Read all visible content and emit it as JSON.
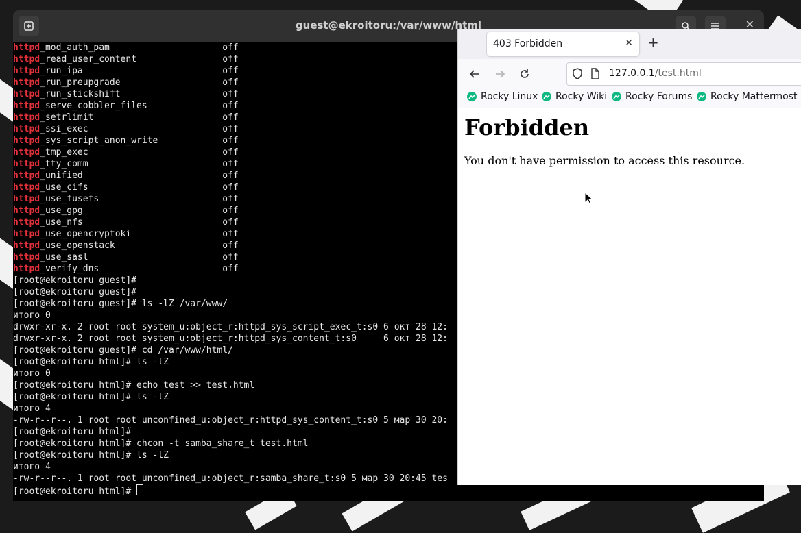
{
  "terminal": {
    "title": "guest@ekroitoru:/var/www/html",
    "lines": [
      [
        {
          "t": "httpd",
          "k": 1
        },
        {
          "t": "_mod_auth_pam                     off"
        }
      ],
      [
        {
          "t": "httpd",
          "k": 1
        },
        {
          "t": "_read_user_content                off"
        }
      ],
      [
        {
          "t": "httpd",
          "k": 1
        },
        {
          "t": "_run_ipa                          off"
        }
      ],
      [
        {
          "t": "httpd",
          "k": 1
        },
        {
          "t": "_run_preupgrade                   off"
        }
      ],
      [
        {
          "t": "httpd",
          "k": 1
        },
        {
          "t": "_run_stickshift                   off"
        }
      ],
      [
        {
          "t": "httpd",
          "k": 1
        },
        {
          "t": "_serve_cobbler_files              off"
        }
      ],
      [
        {
          "t": "httpd",
          "k": 1
        },
        {
          "t": "_setrlimit                        off"
        }
      ],
      [
        {
          "t": "httpd",
          "k": 1
        },
        {
          "t": "_ssi_exec                         off"
        }
      ],
      [
        {
          "t": "httpd",
          "k": 1
        },
        {
          "t": "_sys_script_anon_write            off"
        }
      ],
      [
        {
          "t": "httpd",
          "k": 1
        },
        {
          "t": "_tmp_exec                         off"
        }
      ],
      [
        {
          "t": "httpd",
          "k": 1
        },
        {
          "t": "_tty_comm                         off"
        }
      ],
      [
        {
          "t": "httpd",
          "k": 1
        },
        {
          "t": "_unified                          off"
        }
      ],
      [
        {
          "t": "httpd",
          "k": 1
        },
        {
          "t": "_use_cifs                         off"
        }
      ],
      [
        {
          "t": "httpd",
          "k": 1
        },
        {
          "t": "_use_fusefs                       off"
        }
      ],
      [
        {
          "t": "httpd",
          "k": 1
        },
        {
          "t": "_use_gpg                          off"
        }
      ],
      [
        {
          "t": "httpd",
          "k": 1
        },
        {
          "t": "_use_nfs                          off"
        }
      ],
      [
        {
          "t": "httpd",
          "k": 1
        },
        {
          "t": "_use_opencryptoki                 off"
        }
      ],
      [
        {
          "t": "httpd",
          "k": 1
        },
        {
          "t": "_use_openstack                    off"
        }
      ],
      [
        {
          "t": "httpd",
          "k": 1
        },
        {
          "t": "_use_sasl                         off"
        }
      ],
      [
        {
          "t": "httpd",
          "k": 1
        },
        {
          "t": "_verify_dns                       off"
        }
      ],
      [
        {
          "t": "[root@ekroitoru guest]#"
        }
      ],
      [
        {
          "t": "[root@ekroitoru guest]#"
        }
      ],
      [
        {
          "t": "[root@ekroitoru guest]# ls -lZ /var/www/"
        }
      ],
      [
        {
          "t": "итого 0"
        }
      ],
      [
        {
          "t": "drwxr-xr-x. 2 root root system_u:object_r:httpd_sys_script_exec_t:s0 6 окт 28 12:"
        }
      ],
      [
        {
          "t": "drwxr-xr-x. 2 root root system_u:object_r:httpd_sys_content_t:s0     6 окт 28 12:"
        }
      ],
      [
        {
          "t": "[root@ekroitoru guest]# cd /var/www/html/"
        }
      ],
      [
        {
          "t": "[root@ekroitoru html]# ls -lZ"
        }
      ],
      [
        {
          "t": "итого 0"
        }
      ],
      [
        {
          "t": "[root@ekroitoru html]# echo test >> test.html"
        }
      ],
      [
        {
          "t": "[root@ekroitoru html]# ls -lZ"
        }
      ],
      [
        {
          "t": "итого 4"
        }
      ],
      [
        {
          "t": "-rw-r--r--. 1 root root unconfined_u:object_r:httpd_sys_content_t:s0 5 мар 30 20:"
        }
      ],
      [
        {
          "t": "[root@ekroitoru html]#"
        }
      ],
      [
        {
          "t": "[root@ekroitoru html]# chcon -t samba_share_t test.html"
        }
      ],
      [
        {
          "t": "[root@ekroitoru html]# ls -lZ"
        }
      ],
      [
        {
          "t": "итого 4"
        }
      ],
      [
        {
          "t": "-rw-r--r--. 1 root root unconfined_u:object_r:samba_share_t:s0 5 мар 30 20:45 tes"
        }
      ],
      [
        {
          "t": "[root@ekroitoru html]# "
        }
      ]
    ]
  },
  "browser": {
    "tab_title": "403 Forbidden",
    "url_host": "127.0.0.1",
    "url_path": "/test.html",
    "bookmarks": [
      "Rocky Linux",
      "Rocky Wiki",
      "Rocky Forums",
      "Rocky Mattermost"
    ],
    "heading": "Forbidden",
    "message": "You don't have permission to access this resource."
  },
  "colors": {
    "keyword_red": "#e0303a",
    "rocky_green": "#10b981"
  }
}
